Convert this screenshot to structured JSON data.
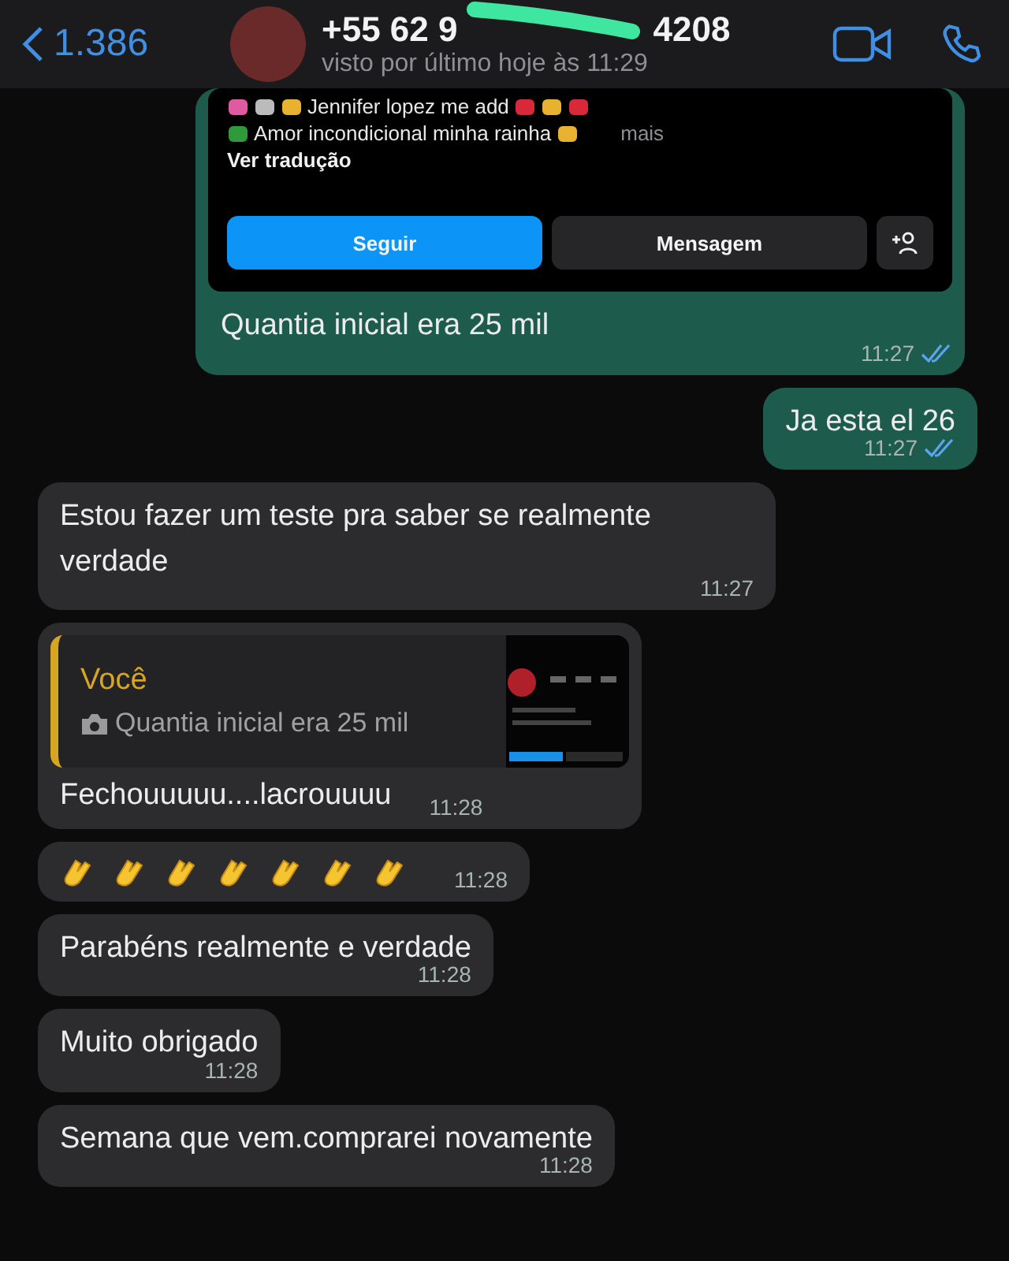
{
  "header": {
    "back_count": "1.386",
    "title_start": "+55 62 9",
    "title_end": "4208",
    "status": "visto por último hoje às 11:29"
  },
  "messages": [
    {
      "kind": "profile_card",
      "outgoing": true,
      "bio_line_1": "Jennifer lopez me add",
      "bio_line_2": "Amor incondicional minha rainha",
      "more": "mais",
      "translate": "Ver tradução",
      "follow": "Seguir",
      "message": "Mensagem",
      "text": "Quantia inicial era 25 mil",
      "time": "11:27",
      "read": true
    },
    {
      "kind": "text",
      "outgoing": true,
      "text": "Ja esta el 26",
      "time": "11:27",
      "read": true
    },
    {
      "kind": "text",
      "outgoing": false,
      "text": "Estou fazer um teste pra saber se realmente verdade",
      "time": "11:27"
    },
    {
      "kind": "reply",
      "outgoing": false,
      "quote_author": "Você",
      "quote_text": "Quantia inicial era 25 mil",
      "text": "Fechouuuuu....lacrouuuu",
      "time": "11:28"
    },
    {
      "kind": "claps",
      "outgoing": false,
      "emojis": [
        {
          "kind": "clap"
        },
        {
          "kind": "clap"
        },
        {
          "kind": "clap"
        },
        {
          "kind": "clap"
        },
        {
          "kind": "clap"
        },
        {
          "kind": "clap"
        },
        {
          "kind": "clap"
        }
      ],
      "time": "11:28"
    },
    {
      "kind": "text",
      "outgoing": false,
      "text": "Parabéns realmente e verdade",
      "time": "11:28"
    },
    {
      "kind": "text",
      "outgoing": false,
      "text": "Muito obrigado",
      "time": "11:28"
    },
    {
      "kind": "text",
      "outgoing": false,
      "text": "Semana que vem.comprarei novamente",
      "time": "11:28"
    }
  ]
}
